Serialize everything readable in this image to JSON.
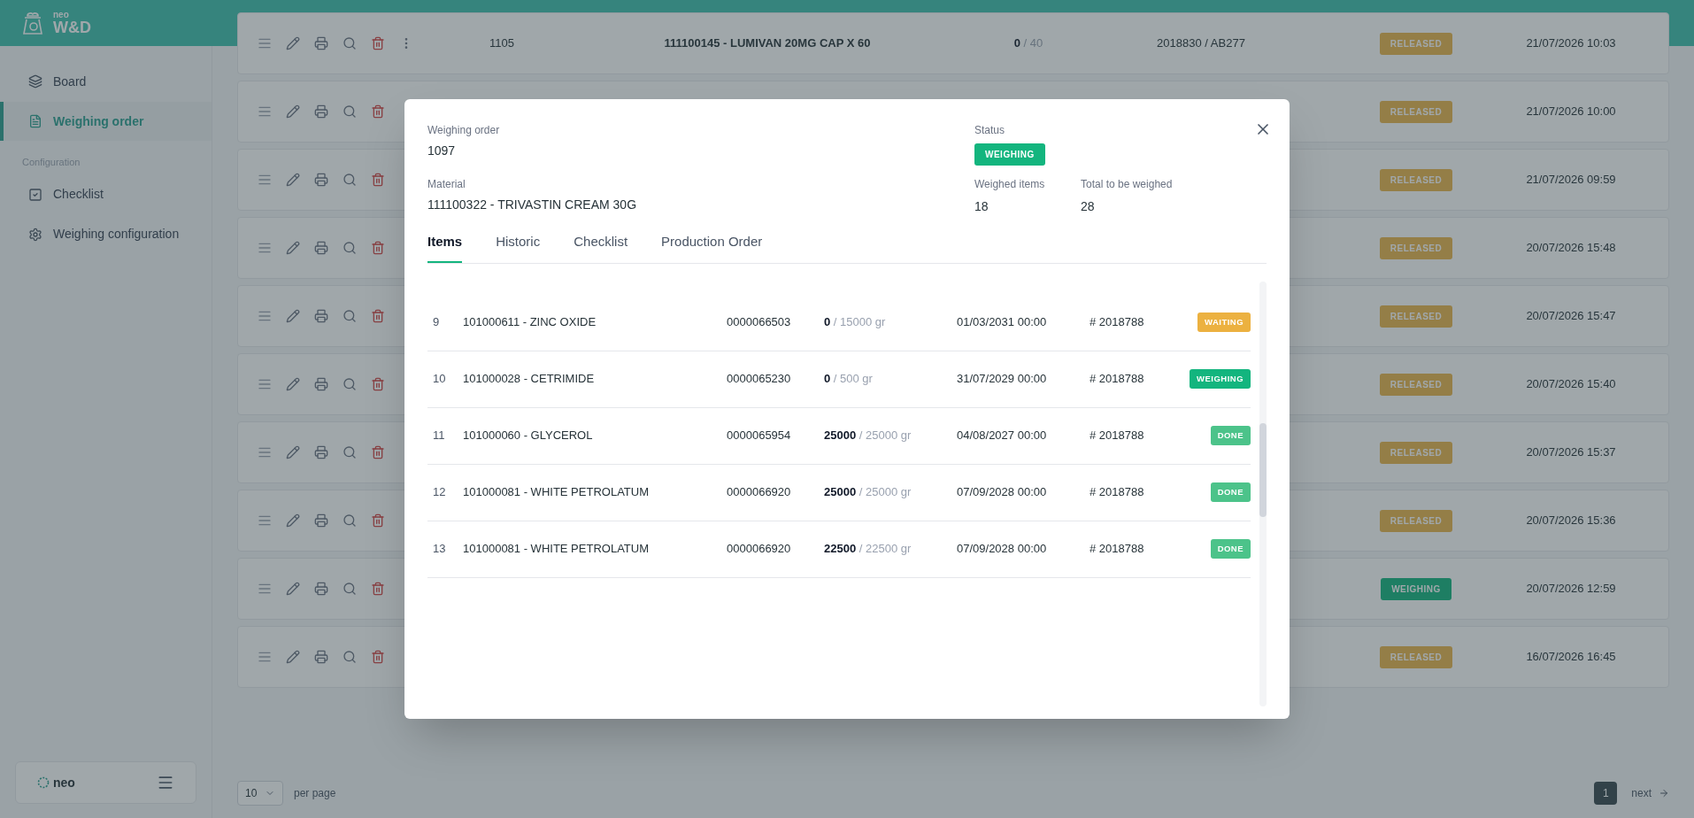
{
  "header": {
    "brand_small": "neo",
    "brand": "W&D"
  },
  "sidebar": {
    "items": [
      {
        "label": "Board",
        "selected": false
      },
      {
        "label": "Weighing order",
        "selected": true
      }
    ],
    "section": "Configuration",
    "config_items": [
      {
        "label": "Checklist",
        "selected": false
      },
      {
        "label": "Weighing configuration",
        "selected": false
      }
    ],
    "footer_logo": "neo"
  },
  "orders": [
    {
      "id": "1105",
      "material": "111100145 - LUMIVAN 20MG CAP X 60",
      "quantity": "**0** / 40",
      "lot": "2018830 / AB277",
      "status": "RELEASED",
      "kind": "released",
      "date": "21/07/2026 10:03"
    },
    {
      "status": "RELEASED",
      "kind": "released",
      "date": "21/07/2026 10:00"
    },
    {
      "status": "RELEASED",
      "kind": "released",
      "date": "21/07/2026 09:59"
    },
    {
      "status": "RELEASED",
      "kind": "released",
      "date": "20/07/2026 15:48"
    },
    {
      "status": "RELEASED",
      "kind": "released",
      "date": "20/07/2026 15:47"
    },
    {
      "status": "RELEASED",
      "kind": "released",
      "date": "20/07/2026 15:40"
    },
    {
      "status": "RELEASED",
      "kind": "released",
      "date": "20/07/2026 15:37"
    },
    {
      "status": "RELEASED",
      "kind": "released",
      "date": "20/07/2026 15:36"
    },
    {
      "status": "WEIGHING",
      "kind": "weighing",
      "date": "20/07/2026 12:59"
    },
    {
      "status": "RELEASED",
      "kind": "released",
      "date": "16/07/2026 16:45"
    }
  ],
  "pagination": {
    "page_size": "10",
    "per_page_label": "per page",
    "pages": [
      {
        "label": "1",
        "selected": true
      }
    ],
    "next": "next"
  },
  "modal": {
    "order_label": "Weighing order",
    "order": "1097",
    "material_label": "Material",
    "material": "111100322 - TRIVASTIN CREAM 30G",
    "status_label": "Status",
    "status": "WEIGHING",
    "weighed_label": "Weighed items",
    "weighed": "18",
    "total_label": "Total to be weighed",
    "total": "28",
    "tabs": [
      {
        "label": "Items",
        "selected": true
      },
      {
        "label": "Historic",
        "selected": false
      },
      {
        "label": "Checklist",
        "selected": false
      },
      {
        "label": "Production Order",
        "selected": false
      }
    ],
    "items": [
      {
        "index": "9",
        "material": "101000611 - ZINC OXIDE",
        "lot": "0000066503",
        "quantity": "**0** / 15000 gr",
        "expiry": "01/03/2031 00:00",
        "order": "# 2018788",
        "status": "WAITING",
        "color": "#ecb140"
      },
      {
        "index": "10",
        "material": "101000028 - CETRIMIDE",
        "lot": "0000065230",
        "quantity": "**0** / 500 gr",
        "expiry": "31/07/2029 00:00",
        "order": "# 2018788",
        "status": "WEIGHING",
        "color": "#13b57e"
      },
      {
        "index": "11",
        "material": "101000060 - GLYCEROL",
        "lot": "0000065954",
        "quantity": "**25000** / 25000 gr",
        "expiry": "04/08/2027 00:00",
        "order": "# 2018788",
        "status": "DONE",
        "color": "#4cc38a"
      },
      {
        "index": "12",
        "material": "101000081 - WHITE PETROLATUM",
        "lot": "0000066920",
        "quantity": "**25000** / 25000 gr",
        "expiry": "07/09/2028 00:00",
        "order": "# 2018788",
        "status": "DONE",
        "color": "#4cc38a"
      },
      {
        "index": "13",
        "material": "101000081 - WHITE PETROLATUM",
        "lot": "0000066920",
        "quantity": "**22500** / 22500 gr",
        "expiry": "07/09/2028 00:00",
        "order": "# 2018788",
        "status": "DONE",
        "color": "#4cc38a"
      }
    ]
  }
}
